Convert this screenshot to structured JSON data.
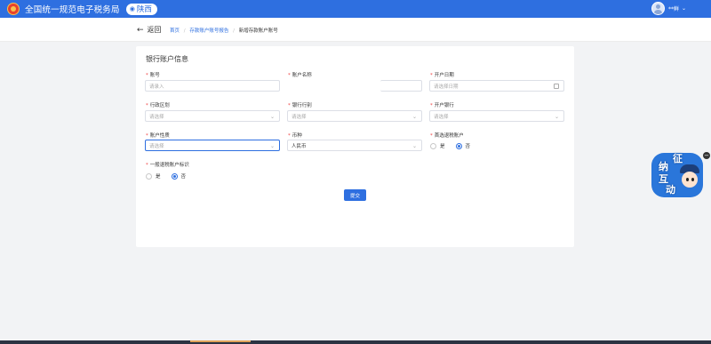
{
  "header": {
    "site_title": "全国统一规范电子税务局",
    "region_label": "陕西",
    "user_name": "**鲜"
  },
  "nav": {
    "back_label": "返回",
    "breadcrumbs": [
      "首页",
      "存款账户账号报告",
      "新增存款账户账号"
    ]
  },
  "form": {
    "section_title": "银行账户信息",
    "fields": {
      "account_no": {
        "label": "账号",
        "placeholder": "请录入",
        "value": ""
      },
      "account_name": {
        "label": "账户名称",
        "value": ""
      },
      "open_date": {
        "label": "开户日期",
        "placeholder": "请选择日期"
      },
      "admin_region": {
        "label": "行政区划",
        "placeholder": "请选择"
      },
      "bank_category": {
        "label": "银行行别",
        "placeholder": "请选择"
      },
      "open_bank": {
        "label": "开户银行",
        "placeholder": "请选择"
      },
      "account_nature": {
        "label": "账户性质",
        "placeholder": "请选择"
      },
      "currency": {
        "label": "币种",
        "value": "人民币"
      },
      "primary_refund": {
        "label": "首选退税账户",
        "options": [
          "是",
          "否"
        ],
        "selected": "否"
      },
      "general_refund": {
        "label": "一般退税账户标识",
        "options": [
          "是",
          "否"
        ],
        "selected": "否"
      }
    },
    "submit_label": "提交"
  },
  "widget": {
    "chars": [
      "征",
      "纳",
      "互",
      "动"
    ]
  },
  "colors": {
    "brand_blue": "#2e6fe0",
    "required_red": "#f04040"
  }
}
